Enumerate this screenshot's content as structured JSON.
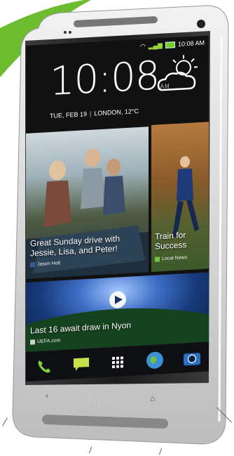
{
  "status": {
    "time": "10:08 AM"
  },
  "clock": {
    "time": "10:08",
    "suffix": "AM"
  },
  "date_line": {
    "date": "TUE, FEB 19",
    "location": "LONDON, 12°C"
  },
  "tiles": [
    {
      "title": "Great Sunday drive with Jessie, Lisa, and Peter!",
      "source": "Jason Holt",
      "source_icon": "facebook-icon"
    },
    {
      "title": "Train for Success",
      "source": "Local News",
      "source_icon": "news-icon"
    },
    {
      "title": "Last 16 await draw in Nyon",
      "source": "UEFA.com",
      "source_icon": "play-icon"
    }
  ],
  "dock": [
    "phone-icon",
    "messages-icon",
    "apps-grid-icon",
    "browser-globe-icon",
    "camera-icon"
  ],
  "brand": "htc",
  "colors": {
    "green": "#6dbb2e",
    "silver": "#d8d8d8"
  }
}
